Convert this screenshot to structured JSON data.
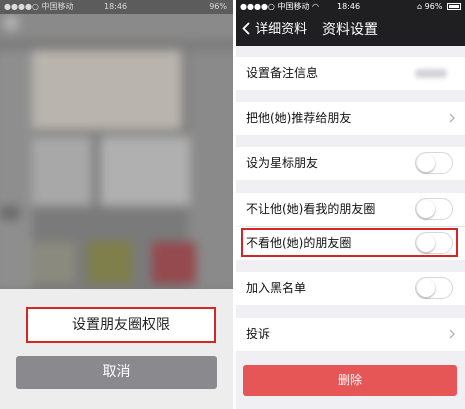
{
  "left": {
    "status": {
      "carrier": "中国移动",
      "time": "18:46",
      "battery": "96%"
    },
    "action_sheet": {
      "option_label": "设置朋友圈权限",
      "cancel_label": "取消"
    },
    "highlight_color": "#d62525"
  },
  "right": {
    "status": {
      "carrier": "中国移动",
      "time": "18:46",
      "battery": "96%"
    },
    "navbar": {
      "back_label": "详细资料",
      "title": "资料设置"
    },
    "rows": [
      {
        "label": "设置备注信息",
        "kind": "value"
      },
      {
        "label": "把他(她)推荐给朋友",
        "kind": "chevron"
      },
      {
        "label": "设为星标朋友",
        "kind": "toggle",
        "on": false
      },
      {
        "label": "不让他(她)看我的朋友圈",
        "kind": "toggle",
        "on": false
      },
      {
        "label": "不看他(她)的朋友圈",
        "kind": "toggle",
        "on": false,
        "highlighted": true
      },
      {
        "label": "加入黑名单",
        "kind": "toggle",
        "on": false
      },
      {
        "label": "投诉",
        "kind": "chevron"
      }
    ],
    "delete_label": "删除",
    "colors": {
      "navbar": "#1f1f22",
      "delete": "#e75656",
      "background": "#efeff4",
      "highlight": "#d62525"
    }
  }
}
